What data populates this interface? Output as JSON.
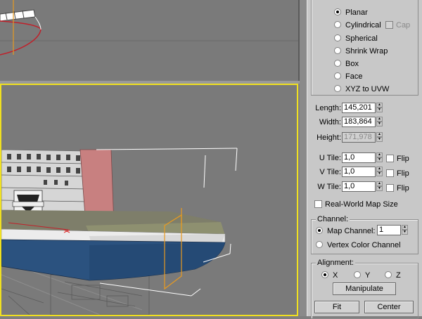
{
  "mapping": {
    "options": [
      {
        "label": "Planar",
        "selected": true
      },
      {
        "label": "Cylindrical",
        "selected": false
      },
      {
        "label": "Spherical",
        "selected": false
      },
      {
        "label": "Shrink Wrap",
        "selected": false
      },
      {
        "label": "Box",
        "selected": false
      },
      {
        "label": "Face",
        "selected": false
      },
      {
        "label": "XYZ to UVW",
        "selected": false
      }
    ],
    "cap_label": "Cap"
  },
  "dimensions": {
    "length_label": "Length:",
    "length_value": "145,201",
    "width_label": "Width:",
    "width_value": "183,864",
    "height_label": "Height:",
    "height_value": "171,978"
  },
  "tiles": [
    {
      "label": "U Tile:",
      "value": "1,0",
      "flip_label": "Flip"
    },
    {
      "label": "V Tile:",
      "value": "1,0",
      "flip_label": "Flip"
    },
    {
      "label": "W Tile:",
      "value": "1,0",
      "flip_label": "Flip"
    }
  ],
  "real_world_label": "Real-World Map Size",
  "channel": {
    "title": "Channel:",
    "map_channel_label": "Map Channel:",
    "map_channel_value": "1",
    "vertex_color_label": "Vertex Color Channel"
  },
  "alignment": {
    "title": "Alignment:",
    "axes": [
      {
        "label": "X",
        "selected": true
      },
      {
        "label": "Y",
        "selected": false
      },
      {
        "label": "Z",
        "selected": false
      }
    ],
    "manipulate_label": "Manipulate",
    "fit_label": "Fit",
    "center_label": "Center"
  },
  "colors": {
    "active_viewport_border": "#f0e020",
    "hull_blue": "#2b527f",
    "gizmo_orange": "#e89a20"
  }
}
